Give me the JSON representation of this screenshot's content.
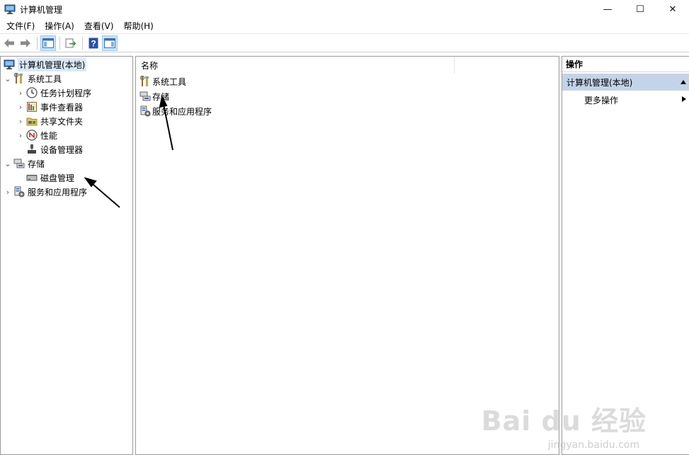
{
  "window": {
    "title": "计算机管理",
    "controls": {
      "minimize": "—",
      "maximize": "☐",
      "close": "✕"
    }
  },
  "menu": [
    {
      "label": "文件(F)"
    },
    {
      "label": "操作(A)"
    },
    {
      "label": "查看(V)"
    },
    {
      "label": "帮助(H)"
    }
  ],
  "toolbar": {
    "icons": [
      "back-arrow-icon",
      "forward-arrow-icon",
      "show-hide-tree-icon",
      "export-list-icon",
      "help-icon",
      "show-hide-action-pane-icon"
    ]
  },
  "tree": {
    "root": "计算机管理(本地)",
    "system_tools": "系统工具",
    "task_scheduler": "任务计划程序",
    "event_viewer": "事件查看器",
    "shared_folders": "共享文件夹",
    "performance": "性能",
    "device_manager": "设备管理器",
    "storage": "存储",
    "disk_management": "磁盘管理",
    "services_apps": "服务和应用程序"
  },
  "center": {
    "column_name": "名称",
    "items": [
      "系统工具",
      "存储",
      "服务和应用程序"
    ]
  },
  "actions": {
    "header": "操作",
    "group": "计算机管理(本地)",
    "more": "更多操作"
  },
  "watermark": {
    "main": "Bai du 经验",
    "sub": "jingyan.baidu.com"
  },
  "colors": {
    "selection": "#dbe9f7",
    "action_group_bg": "#c3d4e8",
    "border": "#9a9a9a"
  }
}
